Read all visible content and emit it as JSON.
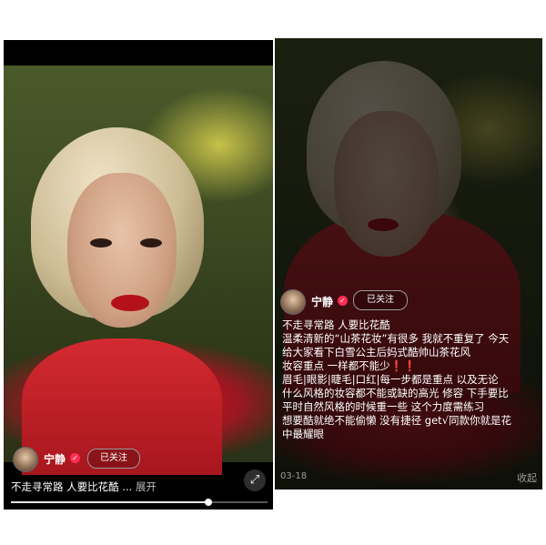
{
  "post": {
    "username": "宁静",
    "follow_label": "已关注",
    "caption_short": "不走寻常路 人要比花酷 ...",
    "more_label": "展开",
    "description_lines": [
      "不走寻常路 人要比花酷",
      "温柔清新的“山茶花妆”有很多  我就不重复了  今天",
      "给大家看下白雪公主后妈式酷帅山茶花风",
      "妆容重点 一样都不能少❗❗",
      "眉毛|眼影|睫毛|口红|每一步都是重点  以及无论",
      "什么风格的妆容都不能或缺的高光  修容  下手要比",
      "平时自然风格的时候重一些  这个力度需练习",
      "想要酷就绝不能偷懒 没有捷径 get√同款你就是花",
      "中最耀眼"
    ],
    "date": "03-18",
    "collapse_label": "收起"
  },
  "player": {
    "progress": 0.77
  },
  "icons": {
    "verified": "verified-badge-icon",
    "expand": "fullscreen-expand-icon"
  },
  "colors": {
    "verified": "#ff2d55",
    "background": "#000000"
  }
}
